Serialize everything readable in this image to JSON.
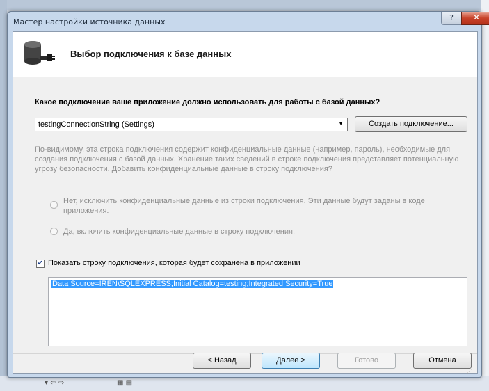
{
  "window": {
    "title": "Мастер настройки источника данных",
    "help_label": "?",
    "close_label": "✕"
  },
  "header": {
    "title": "Выбор подключения к базе данных",
    "icon": "database-icon"
  },
  "connection": {
    "question": "Какое подключение ваше приложение должно использовать для работы с базой данных?",
    "selected": "testingConnectionString (Settings)",
    "create_button": "Создать подключение..."
  },
  "sensitive": {
    "warning": "По-видимому, эта строка подключения содержит конфиденциальные данные (например, пароль), необходимые для создания подключения с базой данных. Хранение таких сведений в строке подключения представляет потенциальную угрозу безопасности. Добавить конфиденциальные данные в строку подключения?",
    "option_no": "Нет, исключить конфиденциальные данные из строки подключения. Эти данные будут заданы в коде приложения.",
    "option_yes": "Да, включить конфиденциальные данные в строку подключения."
  },
  "show_string": {
    "checked": true,
    "label": "Показать строку подключения, которая будет сохранена в приложении",
    "check_mark": "✔",
    "value": "Data Source=IREN\\SQLEXPRESS;Initial Catalog=testing;Integrated Security=True"
  },
  "buttons": {
    "back": "< Назад",
    "next": "Далее >",
    "finish": "Готово",
    "cancel": "Отмена"
  },
  "colors": {
    "selection": "#3399ff",
    "close": "#c8432a"
  }
}
